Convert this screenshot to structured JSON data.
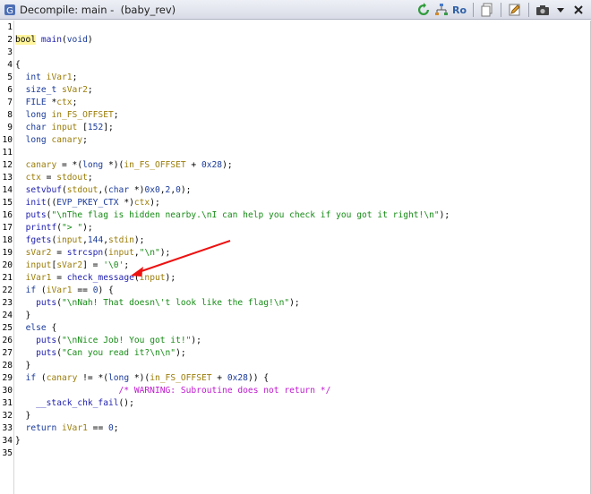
{
  "window": {
    "title": "Decompile: main -  (baby_rev)",
    "toolbar": {
      "ro_label": "Ro",
      "icons": [
        "refresh-icon",
        "graph-icon",
        "ro-icon",
        "copy-icon",
        "edit-icon",
        "snapshot-icon",
        "menu-icon",
        "close-icon"
      ]
    }
  },
  "editor": {
    "line_numbers": [
      "1",
      "2",
      "3",
      "4",
      "5",
      "6",
      "7",
      "8",
      "9",
      "10",
      "11",
      "12",
      "13",
      "14",
      "15",
      "16",
      "17",
      "18",
      "19",
      "20",
      "21",
      "22",
      "23",
      "24",
      "25",
      "26",
      "27",
      "28",
      "29",
      "30",
      "31",
      "32",
      "33",
      "34",
      "35"
    ],
    "lines": [
      [],
      [
        {
          "t": "bool",
          "c": "hl"
        },
        {
          "t": " "
        },
        {
          "t": "main",
          "c": "fn"
        },
        {
          "t": "("
        },
        {
          "t": "void",
          "c": "ty"
        },
        {
          "t": ")"
        }
      ],
      [],
      [
        {
          "t": "{"
        }
      ],
      [
        {
          "t": "  "
        },
        {
          "t": "int",
          "c": "ty"
        },
        {
          "t": " "
        },
        {
          "t": "iVar1",
          "c": "vr"
        },
        {
          "t": ";"
        }
      ],
      [
        {
          "t": "  "
        },
        {
          "t": "size_t",
          "c": "ty"
        },
        {
          "t": " "
        },
        {
          "t": "sVar2",
          "c": "vr"
        },
        {
          "t": ";"
        }
      ],
      [
        {
          "t": "  "
        },
        {
          "t": "FILE",
          "c": "ty"
        },
        {
          "t": " *"
        },
        {
          "t": "ctx",
          "c": "vr"
        },
        {
          "t": ";"
        }
      ],
      [
        {
          "t": "  "
        },
        {
          "t": "long",
          "c": "ty"
        },
        {
          "t": " "
        },
        {
          "t": "in_FS_OFFSET",
          "c": "vr"
        },
        {
          "t": ";"
        }
      ],
      [
        {
          "t": "  "
        },
        {
          "t": "char",
          "c": "ty"
        },
        {
          "t": " "
        },
        {
          "t": "input",
          "c": "vr"
        },
        {
          "t": " ["
        },
        {
          "t": "152",
          "c": "nu"
        },
        {
          "t": "];"
        }
      ],
      [
        {
          "t": "  "
        },
        {
          "t": "long",
          "c": "ty"
        },
        {
          "t": " "
        },
        {
          "t": "canary",
          "c": "vr"
        },
        {
          "t": ";"
        }
      ],
      [],
      [
        {
          "t": "  "
        },
        {
          "t": "canary",
          "c": "vr"
        },
        {
          "t": " = *("
        },
        {
          "t": "long",
          "c": "ty"
        },
        {
          "t": " *)("
        },
        {
          "t": "in_FS_OFFSET",
          "c": "vr"
        },
        {
          "t": " + "
        },
        {
          "t": "0x28",
          "c": "nu"
        },
        {
          "t": ");"
        }
      ],
      [
        {
          "t": "  "
        },
        {
          "t": "ctx",
          "c": "vr"
        },
        {
          "t": " = "
        },
        {
          "t": "stdout",
          "c": "vr"
        },
        {
          "t": ";"
        }
      ],
      [
        {
          "t": "  "
        },
        {
          "t": "setvbuf",
          "c": "fn"
        },
        {
          "t": "("
        },
        {
          "t": "stdout",
          "c": "vr"
        },
        {
          "t": ",("
        },
        {
          "t": "char",
          "c": "ty"
        },
        {
          "t": " *)"
        },
        {
          "t": "0x0",
          "c": "nu"
        },
        {
          "t": ","
        },
        {
          "t": "2",
          "c": "nu"
        },
        {
          "t": ","
        },
        {
          "t": "0",
          "c": "nu"
        },
        {
          "t": ");"
        }
      ],
      [
        {
          "t": "  "
        },
        {
          "t": "init",
          "c": "fn"
        },
        {
          "t": "(("
        },
        {
          "t": "EVP_PKEY_CTX",
          "c": "ty"
        },
        {
          "t": " *)"
        },
        {
          "t": "ctx",
          "c": "vr"
        },
        {
          "t": ");"
        }
      ],
      [
        {
          "t": "  "
        },
        {
          "t": "puts",
          "c": "fn"
        },
        {
          "t": "("
        },
        {
          "t": "\"\\nThe flag is hidden nearby.\\nI can help you check if you got it right!\\n\"",
          "c": "st"
        },
        {
          "t": ");"
        }
      ],
      [
        {
          "t": "  "
        },
        {
          "t": "printf",
          "c": "fn"
        },
        {
          "t": "("
        },
        {
          "t": "\"> \"",
          "c": "st"
        },
        {
          "t": ");"
        }
      ],
      [
        {
          "t": "  "
        },
        {
          "t": "fgets",
          "c": "fn"
        },
        {
          "t": "("
        },
        {
          "t": "input",
          "c": "vr"
        },
        {
          "t": ","
        },
        {
          "t": "144",
          "c": "nu"
        },
        {
          "t": ","
        },
        {
          "t": "stdin",
          "c": "vr"
        },
        {
          "t": ");"
        }
      ],
      [
        {
          "t": "  "
        },
        {
          "t": "sVar2",
          "c": "vr"
        },
        {
          "t": " = "
        },
        {
          "t": "strcspn",
          "c": "fn"
        },
        {
          "t": "("
        },
        {
          "t": "input",
          "c": "vr"
        },
        {
          "t": ","
        },
        {
          "t": "\"\\n\"",
          "c": "st"
        },
        {
          "t": ");"
        }
      ],
      [
        {
          "t": "  "
        },
        {
          "t": "input",
          "c": "vr"
        },
        {
          "t": "["
        },
        {
          "t": "sVar2",
          "c": "vr"
        },
        {
          "t": "] = "
        },
        {
          "t": "'\\0'",
          "c": "st"
        },
        {
          "t": ";"
        }
      ],
      [
        {
          "t": "  "
        },
        {
          "t": "iVar1",
          "c": "vr"
        },
        {
          "t": " = "
        },
        {
          "t": "check_message",
          "c": "fn"
        },
        {
          "t": "("
        },
        {
          "t": "input",
          "c": "vr"
        },
        {
          "t": ");"
        }
      ],
      [
        {
          "t": "  "
        },
        {
          "t": "if",
          "c": "kw"
        },
        {
          "t": " ("
        },
        {
          "t": "iVar1",
          "c": "vr"
        },
        {
          "t": " == "
        },
        {
          "t": "0",
          "c": "nu"
        },
        {
          "t": ") {"
        }
      ],
      [
        {
          "t": "    "
        },
        {
          "t": "puts",
          "c": "fn"
        },
        {
          "t": "("
        },
        {
          "t": "\"\\nNah! That doesn\\'t look like the flag!\\n\"",
          "c": "st"
        },
        {
          "t": ");"
        }
      ],
      [
        {
          "t": "  }"
        }
      ],
      [
        {
          "t": "  "
        },
        {
          "t": "else",
          "c": "kw"
        },
        {
          "t": " {"
        }
      ],
      [
        {
          "t": "    "
        },
        {
          "t": "puts",
          "c": "fn"
        },
        {
          "t": "("
        },
        {
          "t": "\"\\nNice Job! You got it!\"",
          "c": "st"
        },
        {
          "t": ");"
        }
      ],
      [
        {
          "t": "    "
        },
        {
          "t": "puts",
          "c": "fn"
        },
        {
          "t": "("
        },
        {
          "t": "\"Can you read it?\\n\\n\"",
          "c": "st"
        },
        {
          "t": ");"
        }
      ],
      [
        {
          "t": "  }"
        }
      ],
      [
        {
          "t": "  "
        },
        {
          "t": "if",
          "c": "kw"
        },
        {
          "t": " ("
        },
        {
          "t": "canary",
          "c": "vr"
        },
        {
          "t": " != *("
        },
        {
          "t": "long",
          "c": "ty"
        },
        {
          "t": " *)("
        },
        {
          "t": "in_FS_OFFSET",
          "c": "vr"
        },
        {
          "t": " + "
        },
        {
          "t": "0x28",
          "c": "nu"
        },
        {
          "t": ")) {"
        }
      ],
      [
        {
          "t": "                    "
        },
        {
          "t": "/* WARNING: Subroutine does not return */",
          "c": "cm"
        }
      ],
      [
        {
          "t": "    "
        },
        {
          "t": "__stack_chk_fail",
          "c": "fn"
        },
        {
          "t": "();"
        }
      ],
      [
        {
          "t": "  }"
        }
      ],
      [
        {
          "t": "  "
        },
        {
          "t": "return",
          "c": "kw"
        },
        {
          "t": " "
        },
        {
          "t": "iVar1",
          "c": "vr"
        },
        {
          "t": " == "
        },
        {
          "t": "0",
          "c": "nu"
        },
        {
          "t": ";"
        }
      ],
      [
        {
          "t": "}"
        }
      ],
      []
    ]
  }
}
